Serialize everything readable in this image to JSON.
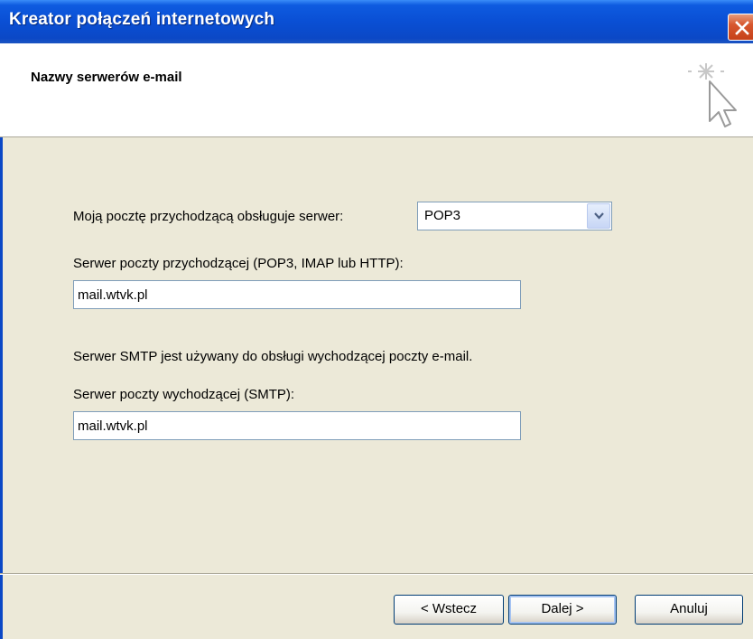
{
  "window": {
    "title": "Kreator połączeń internetowych"
  },
  "header": {
    "title": "Nazwy serwerów e-mail"
  },
  "form": {
    "server_type_label": "Moją pocztę przychodzącą obsługuje serwer:",
    "server_type_value": "POP3",
    "incoming_label": "Serwer poczty przychodzącej (POP3, IMAP lub HTTP):",
    "incoming_value": "mail.wtvk.pl",
    "smtp_info": "Serwer SMTP jest używany do obsługi wychodzącej poczty e-mail.",
    "outgoing_label": "Serwer poczty wychodzącej (SMTP):",
    "outgoing_value": "mail.wtvk.pl"
  },
  "buttons": {
    "back": "< Wstecz",
    "next": "Dalej >",
    "cancel": "Anuluj"
  },
  "icons": {
    "close": "close-icon",
    "wizard": "wizard-cursor-icon",
    "dropdown": "chevron-down-icon"
  },
  "colors": {
    "titlebar": "#0A4FD4",
    "close_button": "#D7572E",
    "background": "#ECE9D8"
  }
}
